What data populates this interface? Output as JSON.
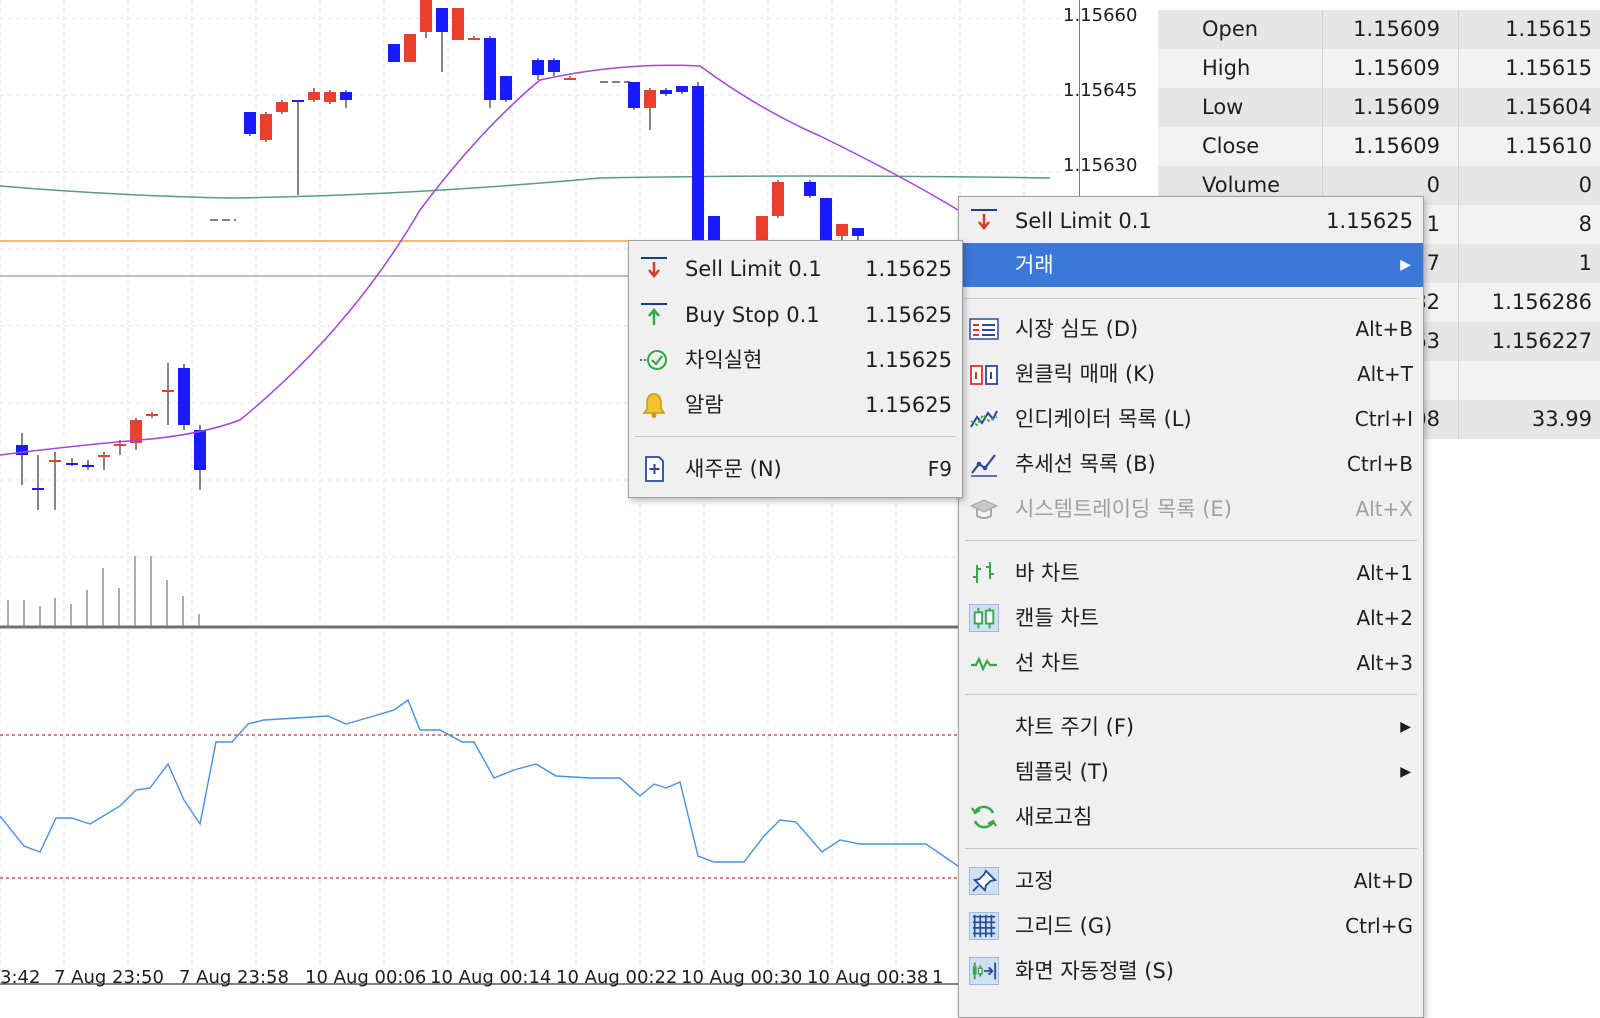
{
  "price_axis": {
    "labels": [
      "1.15660",
      "1.15645",
      "1.15630"
    ]
  },
  "time_axis": {
    "labels": [
      "3:42",
      "7 Aug 23:50",
      "7 Aug 23:58",
      "10 Aug 00:06",
      "10 Aug 00:14",
      "10 Aug 00:22",
      "10 Aug 00:30",
      "10 Aug 00:38",
      "1"
    ]
  },
  "data_window": {
    "rows": [
      {
        "label": "Open",
        "v1": "1.15609",
        "v2": "1.15615"
      },
      {
        "label": "High",
        "v1": "1.15609",
        "v2": "1.15615"
      },
      {
        "label": "Low",
        "v1": "1.15609",
        "v2": "1.15604"
      },
      {
        "label": "Close",
        "v1": "1.15609",
        "v2": "1.15610"
      },
      {
        "label": "Volume",
        "v1": "0",
        "v2": "0"
      },
      {
        "label": "",
        "v1": "1",
        "v2": "8"
      },
      {
        "label": "",
        "v1": "7",
        "v2": "1"
      },
      {
        "label": "",
        "v1": "82",
        "v2": "1.156286"
      },
      {
        "label": "",
        "v1": "63",
        "v2": "1.156227"
      },
      {
        "label": "",
        "v1": "",
        "v2": ""
      },
      {
        "label": "",
        "v1": "08",
        "v2": "33.99"
      }
    ]
  },
  "trade_submenu": {
    "items": [
      {
        "label": "Sell Limit 0.1",
        "value": "1.15625",
        "icon": "sell-arrow-icon"
      },
      {
        "label": "Buy Stop 0.1",
        "value": "1.15625",
        "icon": "buy-arrow-icon"
      },
      {
        "label": "차익실현",
        "value": "1.15625",
        "icon": "take-profit-icon"
      },
      {
        "label": "알람",
        "value": "1.15625",
        "icon": "bell-icon"
      },
      {
        "label": "새주문 (N)",
        "shortcut": "F9",
        "icon": "new-order-icon"
      }
    ]
  },
  "context_menu": {
    "header": {
      "label": "Sell Limit 0.1",
      "value": "1.15625"
    },
    "trade": {
      "label": "거래"
    },
    "items": [
      {
        "label": "시장 심도 (D)",
        "shortcut": "Alt+B"
      },
      {
        "label": "원클릭 매매 (K)",
        "shortcut": "Alt+T"
      },
      {
        "label": "인디케이터 목록 (L)",
        "shortcut": "Ctrl+I"
      },
      {
        "label": "추세선 목록 (B)",
        "shortcut": "Ctrl+B"
      },
      {
        "label": "시스템트레이딩 목록 (E)",
        "shortcut": "Alt+X"
      },
      {
        "label": "바 차트",
        "shortcut": "Alt+1"
      },
      {
        "label": "캔들 차트",
        "shortcut": "Alt+2"
      },
      {
        "label": "선 차트",
        "shortcut": "Alt+3"
      },
      {
        "label": "차트 주기 (F)"
      },
      {
        "label": "템플릿 (T)"
      },
      {
        "label": "새로고침"
      },
      {
        "label": "고정",
        "shortcut": "Alt+D"
      },
      {
        "label": "그리드 (G)",
        "shortcut": "Ctrl+G"
      },
      {
        "label": "화면 자동정렬 (S)"
      }
    ]
  },
  "colors": {
    "bull_candle": "#e8412d",
    "bear_candle": "#1a1aff",
    "moving_average": "#a545d8",
    "long_ma": "#5a9a8a",
    "order_line": "#f0a050",
    "oscillator": "#4a90e2",
    "level_line": "#d03030",
    "menu_highlight": "#3c78d8"
  }
}
